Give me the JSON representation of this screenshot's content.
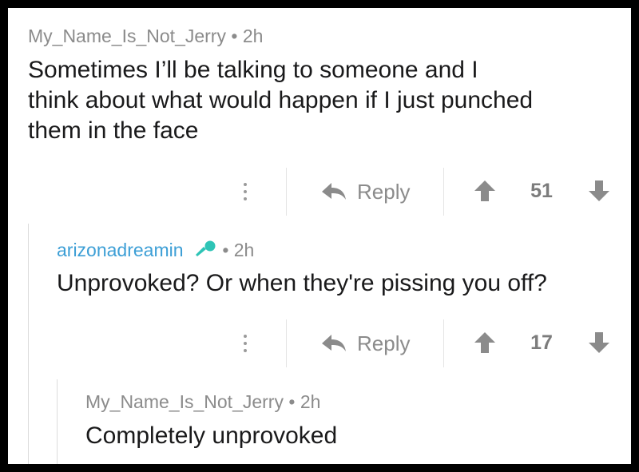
{
  "comments": [
    {
      "author": "My_Name_Is_Not_Jerry",
      "separator": "•",
      "age": "2h",
      "body_lines": [
        "Sometimes I’ll be talking to someone and I",
        "think about what would happen if I just punched",
        "them in the face"
      ],
      "actions": {
        "reply_label": "Reply",
        "score": "51"
      }
    },
    {
      "author": "arizonadreamin",
      "author_flair_icon": "microphone-icon",
      "separator": "•",
      "age": "2h",
      "body_lines": [
        "Unprovoked? Or when they're pissing you off?"
      ],
      "actions": {
        "reply_label": "Reply",
        "score": "17"
      }
    },
    {
      "author": "My_Name_Is_Not_Jerry",
      "separator": "•",
      "age": "2h",
      "body_lines": [
        "Completely unprovoked"
      ]
    }
  ],
  "icons": {
    "more": "more-vertical-icon",
    "reply": "reply-arrow-icon",
    "upvote": "upvote-arrow-icon",
    "downvote": "downvote-arrow-icon"
  },
  "colors": {
    "frame": "#000000",
    "background": "#ffffff",
    "username_link": "#3d9fd6",
    "flair_icon": "#2ec4b6",
    "meta_text": "#8b8b8b",
    "body_text": "#1a1a1b"
  }
}
